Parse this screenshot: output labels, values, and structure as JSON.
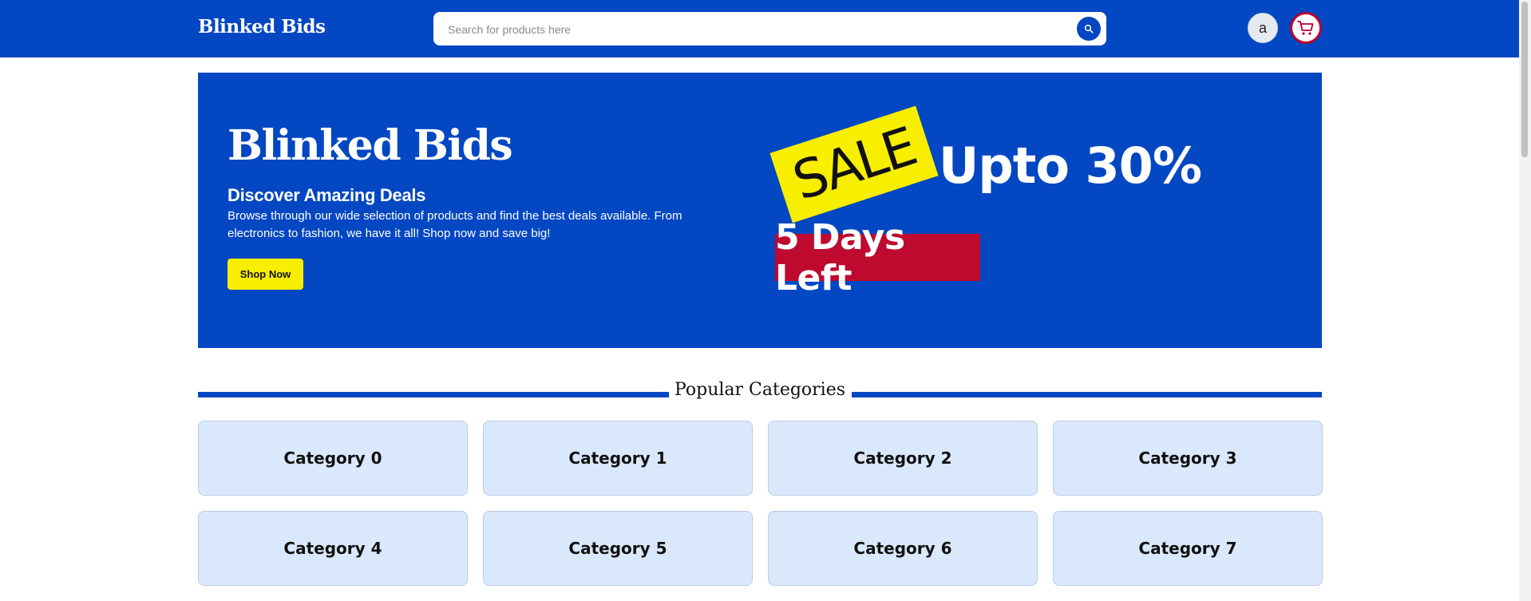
{
  "header": {
    "brand": "Blinked Bids",
    "search": {
      "placeholder": "Search for products here",
      "value": ""
    },
    "avatar_initial": "a",
    "icons": {
      "search": "search-icon",
      "cart": "cart-icon"
    }
  },
  "hero": {
    "title": "Blinked Bids",
    "subtitle": "Discover Amazing Deals",
    "description": "Browse through our wide selection of products and find the best deals available. From electronics to fashion, we have it all! Shop now and save big!",
    "cta_label": "Shop Now",
    "sale_tag": "SALE",
    "discount": "Upto 30%",
    "countdown": "5 Days Left"
  },
  "categories": {
    "heading": "Popular Categories",
    "items": [
      {
        "label": "Category 0"
      },
      {
        "label": "Category 1"
      },
      {
        "label": "Category 2"
      },
      {
        "label": "Category 3"
      },
      {
        "label": "Category 4"
      },
      {
        "label": "Category 5"
      },
      {
        "label": "Category 6"
      },
      {
        "label": "Category 7"
      }
    ]
  },
  "colors": {
    "primary": "#0347c2",
    "accent_yellow": "#f7ee00",
    "accent_red": "#be0a2f",
    "card_bg": "#dae8fc"
  }
}
